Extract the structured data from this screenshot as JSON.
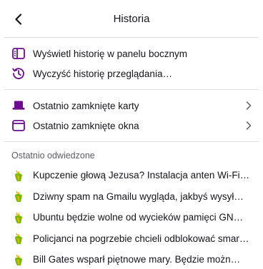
{
  "header": {
    "title": "Historia"
  },
  "actions": [
    {
      "label": "Wyświetl historię w panelu bocznym",
      "icon": "sidebar-icon"
    },
    {
      "label": "Wyczyść historię przeglądania…",
      "icon": "clear-history-icon"
    }
  ],
  "closed": [
    {
      "label": "Ostatnio zamknięte karty",
      "icon": "tabs-icon"
    },
    {
      "label": "Ostatnio zamknięte okna",
      "icon": "window-icon"
    }
  ],
  "recent": {
    "heading": "Ostatnio odwiedzone",
    "items": [
      {
        "label": "Kupczenie głową Jezusa? Instalacja anten Wi-Fi …",
        "icon": "site-favicon-icon"
      },
      {
        "label": "Dziwny spam na Gmailu wygląda, jakbyś wysył…",
        "icon": "site-favicon-icon"
      },
      {
        "label": "Ubuntu będzie wolne od wycieków pamięci GNO…",
        "icon": "site-favicon-icon"
      },
      {
        "label": "Policjanci na pogrzebie chcieli odblokować smar…",
        "icon": "site-favicon-icon"
      },
      {
        "label": "Bill Gates wsparł piętnowe mary. Będzie możn…",
        "icon": "site-favicon-icon"
      }
    ]
  },
  "colors": {
    "accent": "#6e0b8e",
    "favicon_green": "#7ab800",
    "favicon_yellow": "#f2b200",
    "text": "#15141a",
    "muted": "#5b5b66",
    "separator": "#e0e0e6"
  }
}
